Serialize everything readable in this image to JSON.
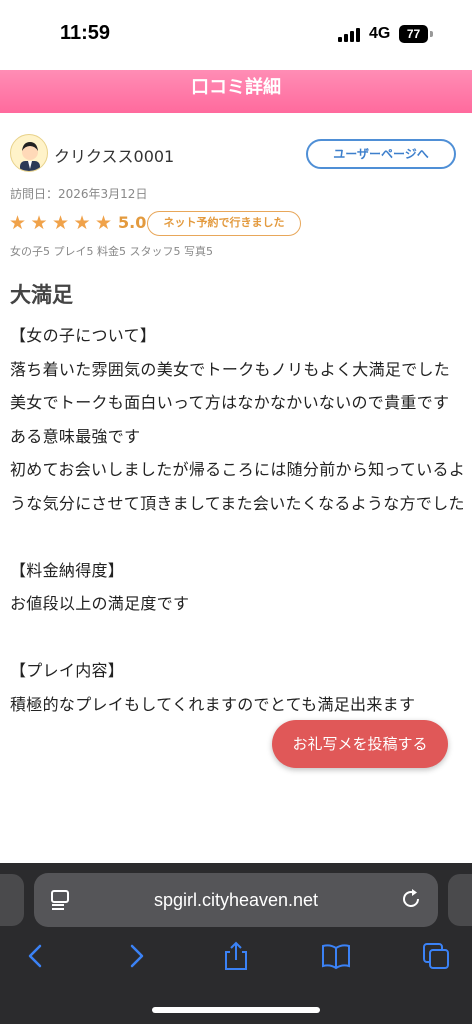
{
  "status_bar": {
    "time": "11:59",
    "network": "4G",
    "battery": "77"
  },
  "header": {
    "title": "口コミ詳細"
  },
  "user": {
    "name": "クリクスス0001",
    "profile_button": "ユーザーページへ"
  },
  "visit_date": "訪問日：2026年3月12日",
  "rating": {
    "stars": 5,
    "score": "5.0",
    "badge": "ネット予約で行きました"
  },
  "sub_scores": "女の子5 プレイ5 料金5 スタッフ5 写真5",
  "review": {
    "title": "大満足",
    "body": "【女の子について】\n落ち着いた雰囲気の美女でトークもノリもよく大満足でした\n美女でトークも面白いって方はなかなかいないので貴重です\nある意味最強です\n初めてお会いしましたが帰るころには随分前から知っているような気分にさせて頂きましてまた会いたくなるような方でした\n\n【料金納得度】\nお値段以上の満足度です\n\n【プレイ内容】\n積極的なプレイもしてくれますのでとても満足出来ます"
  },
  "photo_post_button": "お礼写メを投稿する",
  "browser": {
    "url": "spgirl.cityheaven.net",
    "icons": [
      "reader-icon",
      "reload-icon",
      "back-icon",
      "forward-icon",
      "share-icon",
      "bookmarks-icon",
      "tabs-icon"
    ]
  },
  "colors": {
    "header_pink": "#ff7aa8",
    "star_orange": "#f0a24a",
    "button_blue": "#4f8fd6",
    "post_button_red": "#e05858",
    "browser_icon_blue": "#3b82f6"
  }
}
